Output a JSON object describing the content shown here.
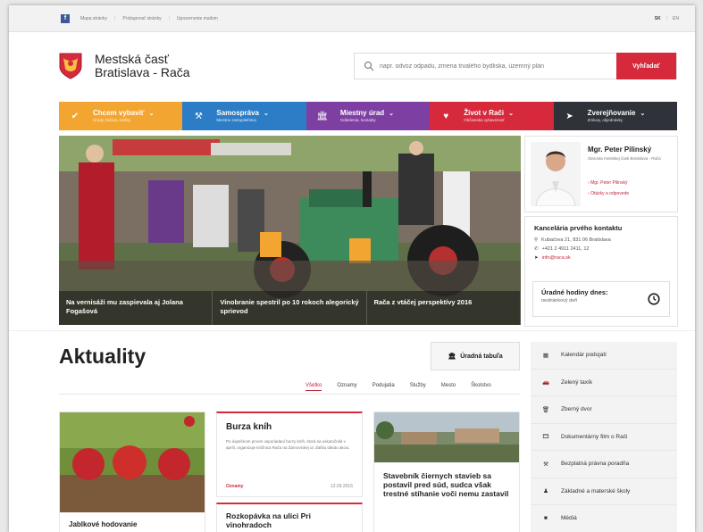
{
  "topbar": {
    "facebook": "f",
    "links": [
      "Mapa stránky",
      "Prístupnosť stránky",
      "Upozornenie mailom"
    ],
    "lang": [
      "SK",
      "EN"
    ]
  },
  "header": {
    "title_line1": "Mestská časť",
    "title_line2": "Bratislava - Rača",
    "search_placeholder": "napr. odvoz odpadu, zmena trvalého bydliska, územný plán",
    "search_button": "Vyhľadať"
  },
  "nav": [
    {
      "title": "Chcem vybaviť",
      "sub": "Úrady, tlačivá, služby",
      "color": "#f3a532",
      "icon": "check-icon"
    },
    {
      "title": "Samospráva",
      "sub": "Miestne zastupiteľstvo",
      "color": "#2c7cc6",
      "icon": "hammer-icon"
    },
    {
      "title": "Miestny úrad",
      "sub": "Oddelenia, kontakty",
      "color": "#7e3fa3",
      "icon": "building-icon"
    },
    {
      "title": "Život v Rači",
      "sub": "Občianska vybavenosť",
      "color": "#d6293c",
      "icon": "heart-icon"
    },
    {
      "title": "Zverejňovanie",
      "sub": "Zmluvy, objednávky",
      "color": "#2f3339",
      "icon": "send-icon"
    }
  ],
  "hero": {
    "captions": [
      "Na vernisáži mu zaspievala aj Jolana Fogašová",
      "Vinobranie spestril po 10 rokoch alegorický sprievod",
      "Rača z vtáčej perspektívy 2016"
    ]
  },
  "person": {
    "name": "Mgr. Peter Pilinský",
    "role": "Starosta mestskej časti Bratislava - Rača",
    "links": [
      "Mgr. Peter Pilinský",
      "Otázky a odpovede"
    ]
  },
  "office": {
    "title": "Kancelária prvého kontaktu",
    "address": "Kubačova 21, 831 06 Bratislava",
    "phone": "+421 2 4911 2411, 12",
    "email": "info@raca.sk",
    "hours_title": "Úradné hodiny dnes:",
    "hours_value": "nestránkový deň"
  },
  "news": {
    "title": "Aktuality",
    "board_button": "Úradná tabuľa",
    "filters": [
      "Všetko",
      "Oznamy",
      "Podujatia",
      "Služby",
      "Mesto",
      "Školstvo"
    ],
    "cards": [
      {
        "title": "Jablkové hodovanie"
      },
      {
        "title": "Burza kníh",
        "text": "Po úspešnom prvom usporiadaní burzy kníh, ktorá sa uskutočnila v apríli, organizuje knižnica Rača na Žarnovickej ul. ďalšiu takúto akciu.",
        "tag": "Oznamy",
        "date": "12.09.2016"
      },
      {
        "title": "Rozkopávka na ulici Pri vinohradoch"
      },
      {
        "title": "Stavebník čiernych stavieb sa postavil pred súd, sudca však trestné stíhanie voči nemu zastavil"
      }
    ]
  },
  "sidebar": [
    {
      "label": "Kalendár podujatí",
      "icon": "calendar-icon"
    },
    {
      "label": "Zelený taxík",
      "icon": "car-icon"
    },
    {
      "label": "Zberný dvor",
      "icon": "trash-icon"
    },
    {
      "label": "Dokumentárny film o Rači",
      "icon": "film-icon"
    },
    {
      "label": "Bezplatná právna poradňa",
      "icon": "gavel-icon"
    },
    {
      "label": "Základné a materské školy",
      "icon": "child-icon"
    },
    {
      "label": "Médiá",
      "icon": "video-icon"
    }
  ]
}
